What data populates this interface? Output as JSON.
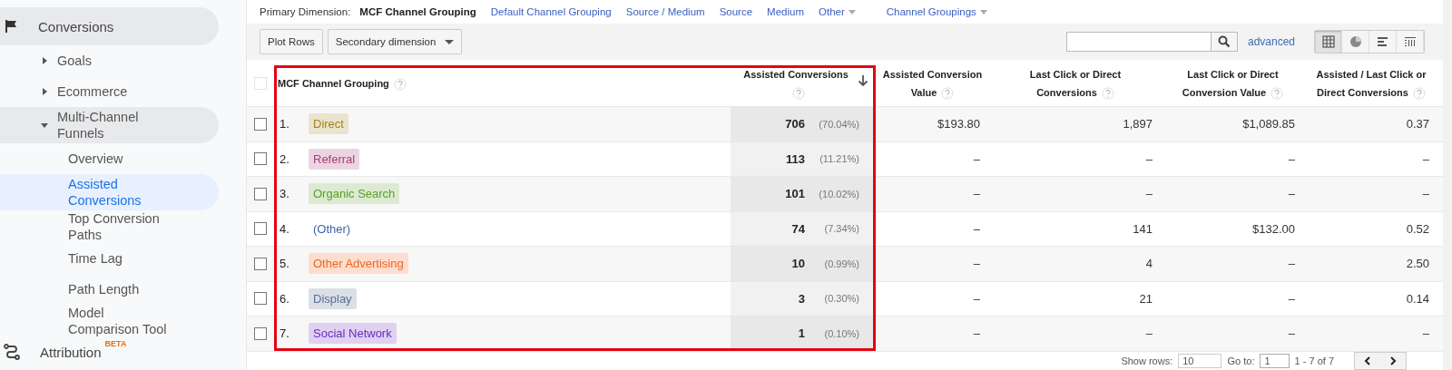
{
  "sidebar": {
    "items": [
      {
        "label": "Conversions",
        "kind": "flag",
        "highlighted": true,
        "children": [
          {
            "label": "Goals",
            "expanded": false
          },
          {
            "label": "Ecommerce",
            "expanded": false
          },
          {
            "label": "Multi-Channel Funnels",
            "expanded": true,
            "children": [
              {
                "label": "Overview",
                "selected": false
              },
              {
                "label": "Assisted Conversions",
                "selected": true
              },
              {
                "label": "Top Conversion Paths",
                "selected": false
              },
              {
                "label": "Time Lag",
                "selected": false
              },
              {
                "label": "Path Length",
                "selected": false
              },
              {
                "label": "Model Comparison Tool",
                "selected": false
              }
            ]
          }
        ]
      },
      {
        "label": "Attribution",
        "kind": "route",
        "highlighted": false,
        "badge": "BETA"
      }
    ]
  },
  "primary_dimension": {
    "label": "Primary Dimension:",
    "options": [
      {
        "label": "MCF Channel Grouping",
        "selected": true,
        "dropdown": false
      },
      {
        "label": "Default Channel Grouping",
        "selected": false,
        "dropdown": false
      },
      {
        "label": "Source / Medium",
        "selected": false,
        "dropdown": false
      },
      {
        "label": "Source",
        "selected": false,
        "dropdown": false
      },
      {
        "label": "Medium",
        "selected": false,
        "dropdown": false
      },
      {
        "label": "Other",
        "selected": false,
        "dropdown": true
      },
      {
        "label": "Channel Groupings",
        "selected": false,
        "dropdown": true
      }
    ]
  },
  "toolbar": {
    "plot_rows": "Plot Rows",
    "secondary_dimension": "Secondary dimension",
    "advanced": "advanced",
    "views": [
      {
        "kind": "table",
        "selected": true
      },
      {
        "kind": "pie",
        "selected": false
      },
      {
        "kind": "bars",
        "selected": false
      },
      {
        "kind": "pivot",
        "selected": false
      }
    ]
  },
  "table": {
    "all_checked": false,
    "columns": [
      {
        "label": "MCF Channel Grouping",
        "sorted": false
      },
      {
        "label": "Assisted Conversions",
        "sorted": true
      },
      {
        "label": "Assisted Conversion Value",
        "sorted": false
      },
      {
        "label": "Last Click or Direct Conversions",
        "sorted": false
      },
      {
        "label": "Last Click or Direct Conversion Value",
        "sorted": false
      },
      {
        "label": "Assisted / Last Click or Direct Conversions",
        "sorted": false
      }
    ],
    "rows": [
      {
        "index": "1.",
        "channel": "Direct",
        "color": "#a08420",
        "tagged": true,
        "checked": false,
        "assisted_conversions": "706",
        "share": "(70.04%)",
        "assisted_conversion_value": "$193.80",
        "last_click_conversions": "1,897",
        "last_click_conversion_value": "$1,089.85",
        "ratio": "0.37"
      },
      {
        "index": "2.",
        "channel": "Referral",
        "color": "#a8407a",
        "tagged": true,
        "checked": false,
        "assisted_conversions": "113",
        "share": "(11.21%)",
        "assisted_conversion_value": "–",
        "last_click_conversions": "–",
        "last_click_conversion_value": "–",
        "ratio": "–"
      },
      {
        "index": "3.",
        "channel": "Organic Search",
        "color": "#5a9e2a",
        "tagged": true,
        "checked": false,
        "assisted_conversions": "101",
        "share": "(10.02%)",
        "assisted_conversion_value": "–",
        "last_click_conversions": "–",
        "last_click_conversion_value": "–",
        "ratio": "–"
      },
      {
        "index": "4.",
        "channel": "(Other)",
        "color": "#3d62ad",
        "tagged": false,
        "checked": false,
        "assisted_conversions": "74",
        "share": "(7.34%)",
        "assisted_conversion_value": "–",
        "last_click_conversions": "141",
        "last_click_conversion_value": "$132.00",
        "ratio": "0.52"
      },
      {
        "index": "5.",
        "channel": "Other Advertising",
        "color": "#f0661e",
        "tagged": true,
        "checked": false,
        "assisted_conversions": "10",
        "share": "(0.99%)",
        "assisted_conversion_value": "–",
        "last_click_conversions": "4",
        "last_click_conversion_value": "–",
        "ratio": "2.50"
      },
      {
        "index": "6.",
        "channel": "Display",
        "color": "#5a6e90",
        "tagged": true,
        "checked": false,
        "assisted_conversions": "3",
        "share": "(0.30%)",
        "assisted_conversion_value": "–",
        "last_click_conversions": "21",
        "last_click_conversion_value": "–",
        "ratio": "0.14"
      },
      {
        "index": "7.",
        "channel": "Social Network",
        "color": "#6a2cc0",
        "tagged": true,
        "checked": false,
        "assisted_conversions": "1",
        "share": "(0.10%)",
        "assisted_conversion_value": "–",
        "last_click_conversions": "–",
        "last_click_conversion_value": "–",
        "ratio": "–"
      }
    ]
  },
  "pagination": {
    "show_rows_label": "Show rows:",
    "show_rows": "10",
    "goto_label": "Go to:",
    "goto": "1",
    "range": "1 - 7 of 7"
  }
}
